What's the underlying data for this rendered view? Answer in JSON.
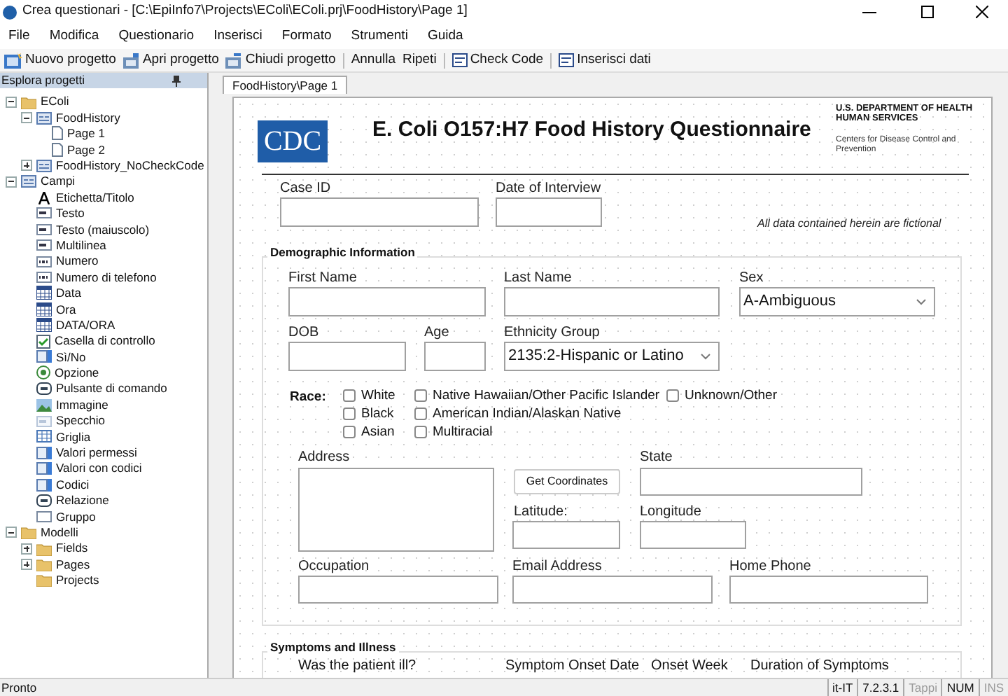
{
  "window": {
    "title": "Crea questionari - [C:\\EpiInfo7\\Projects\\EColi\\EColi.prj\\FoodHistory\\Page 1]"
  },
  "menu": [
    "File",
    "Modifica",
    "Questionario",
    "Inserisci",
    "Formato",
    "Strumenti",
    "Guida"
  ],
  "toolbar": [
    {
      "label": "Nuovo progetto",
      "kind": "new"
    },
    {
      "label": "Apri progetto",
      "kind": "open"
    },
    {
      "label": "Chiudi progetto",
      "kind": "close"
    },
    {
      "label": "Annulla",
      "kind": "plain"
    },
    {
      "label": "Ripeti",
      "kind": "plain"
    },
    {
      "label": "Check Code",
      "kind": "code"
    },
    {
      "label": "Inserisci dati",
      "kind": "code"
    }
  ],
  "explorer": {
    "title": "Esplora progetti",
    "items": [
      {
        "label": "EColi",
        "kind": "project",
        "expanded": true,
        "children": [
          {
            "label": "FoodHistory",
            "kind": "form",
            "expanded": true,
            "children": [
              {
                "label": "Page 1",
                "kind": "page"
              },
              {
                "label": "Page 2",
                "kind": "page"
              }
            ]
          },
          {
            "label": "FoodHistory_NoCheckCode",
            "kind": "form",
            "expanded": false
          }
        ]
      },
      {
        "label": "Campi",
        "kind": "form",
        "expanded": true,
        "children": [
          {
            "label": "Etichetta/Titolo",
            "kind": "label"
          },
          {
            "label": "Testo",
            "kind": "text"
          },
          {
            "label": "Testo (maiuscolo)",
            "kind": "text"
          },
          {
            "label": "Multilinea",
            "kind": "text"
          },
          {
            "label": "Numero",
            "kind": "number"
          },
          {
            "label": "Numero di telefono",
            "kind": "number"
          },
          {
            "label": "Data",
            "kind": "date"
          },
          {
            "label": "Ora",
            "kind": "date"
          },
          {
            "label": "DATA/ORA",
            "kind": "date"
          },
          {
            "label": "Casella di controllo",
            "kind": "check"
          },
          {
            "label": "Sì/No",
            "kind": "list"
          },
          {
            "label": "Opzione",
            "kind": "option"
          },
          {
            "label": "Pulsante di comando",
            "kind": "button"
          },
          {
            "label": "Immagine",
            "kind": "image"
          },
          {
            "label": "Specchio",
            "kind": "mirror"
          },
          {
            "label": "Griglia",
            "kind": "grid"
          },
          {
            "label": "Valori permessi",
            "kind": "list"
          },
          {
            "label": "Valori con codici",
            "kind": "list"
          },
          {
            "label": "Codici",
            "kind": "list"
          },
          {
            "label": "Relazione",
            "kind": "button"
          },
          {
            "label": "Gruppo",
            "kind": "group"
          }
        ]
      },
      {
        "label": "Modelli",
        "kind": "folder",
        "expanded": true,
        "children": [
          {
            "label": "Fields",
            "kind": "folder",
            "expanded": false
          },
          {
            "label": "Pages",
            "kind": "folder",
            "expanded": false
          },
          {
            "label": "Projects",
            "kind": "folder"
          }
        ]
      }
    ]
  },
  "tab": {
    "label": "FoodHistory\\Page 1"
  },
  "form": {
    "logo": "CDC",
    "title": "E. Coli O157:H7 Food History Questionnaire",
    "agency": "U.S. DEPARTMENT OF HEALTH HUMAN SERVICES",
    "agency_sub": "Centers for Disease Control and Prevention",
    "note": "All data contained herein are fictional",
    "fields": [
      {
        "label": "Case ID",
        "kind": "text"
      },
      {
        "label": "Date of Interview",
        "kind": "text"
      },
      {
        "label": "First Name",
        "kind": "text"
      },
      {
        "label": "Last Name",
        "kind": "text"
      },
      {
        "label": "Sex",
        "kind": "select",
        "value": "A-Ambiguous"
      },
      {
        "label": "DOB",
        "kind": "text"
      },
      {
        "label": "Age",
        "kind": "text"
      },
      {
        "label": "Ethnicity Group",
        "kind": "select",
        "value": "2135:2-Hispanic or Latino"
      },
      {
        "label": "Address",
        "kind": "textarea"
      },
      {
        "label": "State",
        "kind": "text"
      },
      {
        "label": "Latitude:",
        "kind": "text"
      },
      {
        "label": "Longitude",
        "kind": "text"
      },
      {
        "label": "Occupation",
        "kind": "text"
      },
      {
        "label": "Email Address",
        "kind": "text"
      },
      {
        "label": "Home Phone",
        "kind": "text"
      }
    ],
    "groups": [
      "Demographic Information",
      "Symptoms and Illness"
    ],
    "race_label": "Race:",
    "race": [
      {
        "label": "White",
        "checked": false
      },
      {
        "label": "Black",
        "checked": false
      },
      {
        "label": "Asian",
        "checked": false
      },
      {
        "label": "Native Hawaiian/Other Pacific Islander",
        "checked": false
      },
      {
        "label": "American Indian/Alaskan Native",
        "checked": false
      },
      {
        "label": "Multiracial",
        "checked": false
      },
      {
        "label": "Unknown/Other",
        "checked": false
      }
    ],
    "button": "Get Coordinates",
    "symptom_labels": [
      "Was the patient ill?",
      "Symptom Onset Date",
      "Onset Week",
      "Duration of Symptoms"
    ]
  },
  "status_bar": {
    "message": "Pronto",
    "panels": [
      {
        "label": "it-IT",
        "disabled": false
      },
      {
        "label": "7.2.3.1",
        "disabled": false
      },
      {
        "label": "Tappi",
        "disabled": true
      },
      {
        "label": "NUM",
        "disabled": false
      },
      {
        "label": "INS",
        "disabled": true
      }
    ]
  }
}
